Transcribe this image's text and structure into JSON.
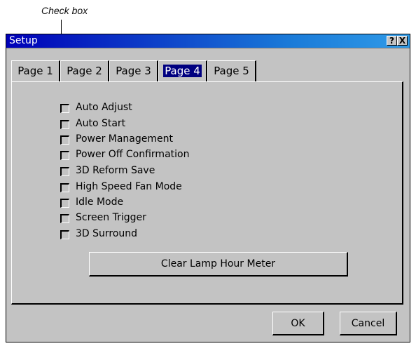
{
  "annotation": {
    "label": "Check box"
  },
  "window": {
    "title": "Setup",
    "help_glyph": "?",
    "close_glyph": "X"
  },
  "tabs": [
    {
      "label": "Page 1",
      "active": false
    },
    {
      "label": "Page 2",
      "active": false
    },
    {
      "label": "Page 3",
      "active": false
    },
    {
      "label": "Page 4",
      "active": true
    },
    {
      "label": "Page 5",
      "active": false
    }
  ],
  "options": [
    {
      "label": "Auto Adjust",
      "checked": false
    },
    {
      "label": "Auto Start",
      "checked": false
    },
    {
      "label": "Power Management",
      "checked": false
    },
    {
      "label": "Power Off Confirmation",
      "checked": false
    },
    {
      "label": "3D Reform Save",
      "checked": false
    },
    {
      "label": "High Speed Fan Mode",
      "checked": false
    },
    {
      "label": "Idle Mode",
      "checked": false
    },
    {
      "label": "Screen Trigger",
      "checked": false
    },
    {
      "label": "3D Surround",
      "checked": false
    }
  ],
  "buttons": {
    "clear_lamp": "Clear Lamp Hour Meter",
    "ok": "OK",
    "cancel": "Cancel"
  }
}
